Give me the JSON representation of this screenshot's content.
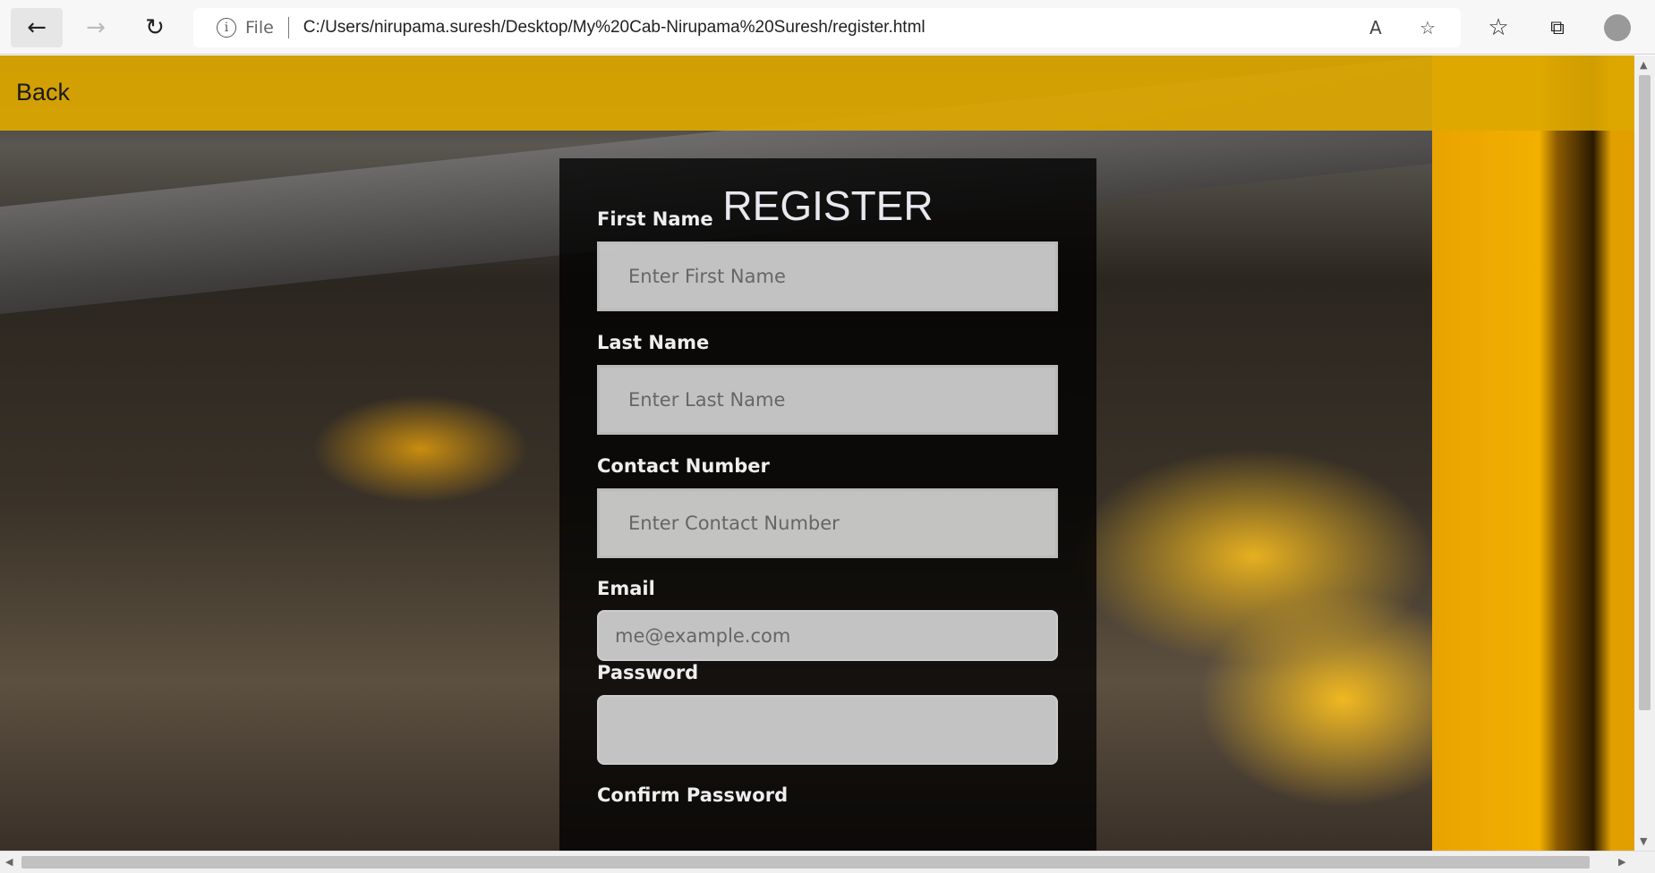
{
  "browser": {
    "address_prefix": "File",
    "url": "C:/Users/nirupama.suresh/Desktop/My%20Cab-Nirupama%20Suresh/register.html",
    "icons": [
      "back-arrow-icon",
      "forward-arrow-icon",
      "refresh-icon",
      "info-icon",
      "read-aloud-icon",
      "add-favorite-icon",
      "favorites-icon",
      "collections-icon",
      "profile-icon"
    ]
  },
  "header": {
    "back_label": "Back",
    "color": "#dea800"
  },
  "form": {
    "title": "REGISTER",
    "fields": [
      {
        "label": "First Name",
        "placeholder": "Enter First Name"
      },
      {
        "label": "Last Name",
        "placeholder": "Enter Last Name"
      },
      {
        "label": "Contact Number",
        "placeholder": "Enter Contact Number"
      },
      {
        "label": "Email",
        "placeholder": "me@example.com"
      },
      {
        "label": "Password",
        "placeholder": ""
      },
      {
        "label": "Confirm Password"
      }
    ]
  }
}
